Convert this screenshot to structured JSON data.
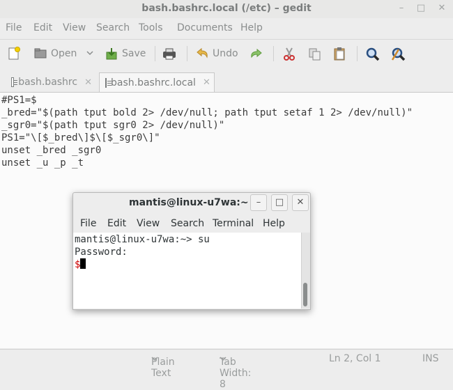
{
  "window": {
    "title": "bash.bashrc.local (/etc) – gedit",
    "minimize": "–",
    "maximize": "□",
    "close": "✕"
  },
  "menubar": [
    "File",
    "Edit",
    "View",
    "Search",
    "Tools",
    "Documents",
    "Help"
  ],
  "toolbar": {
    "open_label": "Open",
    "save_label": "Save",
    "undo_label": "Undo"
  },
  "tabs": [
    {
      "label": "bash.bashrc",
      "close": "✕"
    },
    {
      "label": "bash.bashrc.local",
      "close": "✕"
    }
  ],
  "editor": {
    "lines": [
      "#PS1=$",
      "_bred=\"$(path tput bold 2> /dev/null; path tput setaf 1 2> /dev/null)\"",
      "_sgr0=\"$(path tput sgr0 2> /dev/null)\"",
      "PS1=\"\\[$_bred\\]$\\[$_sgr0\\]\"",
      "unset _bred _sgr0",
      "unset _u _p _t"
    ]
  },
  "statusbar": {
    "language": "Plain Text",
    "tab_width": "Tab Width: 8",
    "position": "Ln 2, Col 1",
    "mode": "INS"
  },
  "terminal": {
    "title": "mantis@linux-u7wa:~",
    "minimize": "–",
    "maximize": "□",
    "close": "✕",
    "menu": [
      "File",
      "Edit",
      "View",
      "Search",
      "Terminal",
      "Help"
    ],
    "line1": "mantis@linux-u7wa:~> su",
    "line2": "Password:",
    "prompt": "$"
  },
  "colors": {
    "prompt": "#cc0000",
    "editor_bg": "#fbfbfb"
  }
}
